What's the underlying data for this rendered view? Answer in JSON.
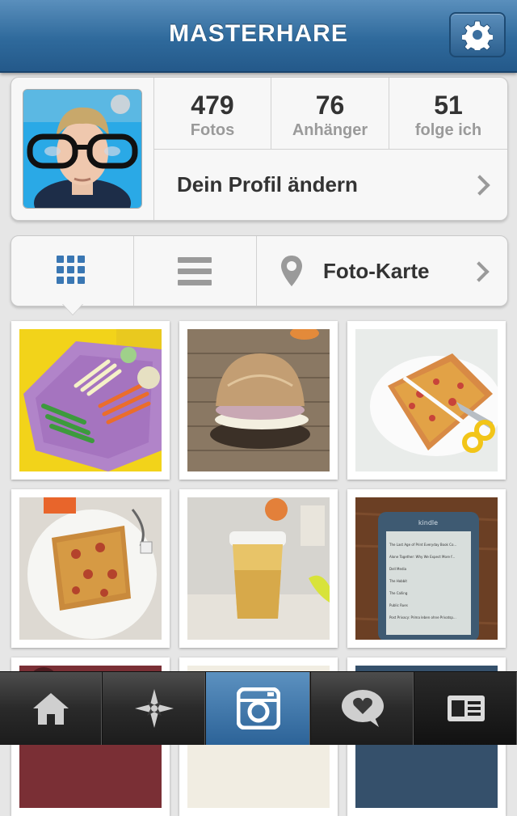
{
  "header": {
    "title": "MASTERHARE"
  },
  "icons": {
    "settings": "gear-icon",
    "grid_view": "grid-icon",
    "list_view": "list-icon",
    "map": "map-pin-icon",
    "home": "home-icon",
    "explore": "star-compass-icon",
    "camera": "camera-icon",
    "activity": "heart-bubble-icon",
    "profile": "profile-card-icon"
  },
  "profile": {
    "stats": [
      {
        "value": "479",
        "label": "Fotos"
      },
      {
        "value": "76",
        "label": "Anhänger"
      },
      {
        "value": "51",
        "label": "folge ich"
      }
    ],
    "edit_label": "Dein Profil ändern"
  },
  "view_switcher": {
    "map_label": "Foto-Karte"
  },
  "photos": [
    {
      "subject": "vegetables-on-plate"
    },
    {
      "subject": "sandwich"
    },
    {
      "subject": "pizza-with-scissors"
    },
    {
      "subject": "pizza-slice"
    },
    {
      "subject": "juice-cup"
    },
    {
      "subject": "kindle"
    }
  ],
  "kindle_screen": {
    "brand": "kindle",
    "items": [
      "The Last Age of Print Everyday Book Co...",
      "Alone Together: Why We Expect More f...",
      "Dell Media",
      "The Hobbit",
      "The Calling",
      "Public Rues",
      "Post Privacy: Prima leben ohne Privatsp..."
    ]
  },
  "colors": {
    "accent": "#2f6a9c",
    "active_tab": "#3f78ad",
    "grid_icon": "#3a77b3"
  }
}
